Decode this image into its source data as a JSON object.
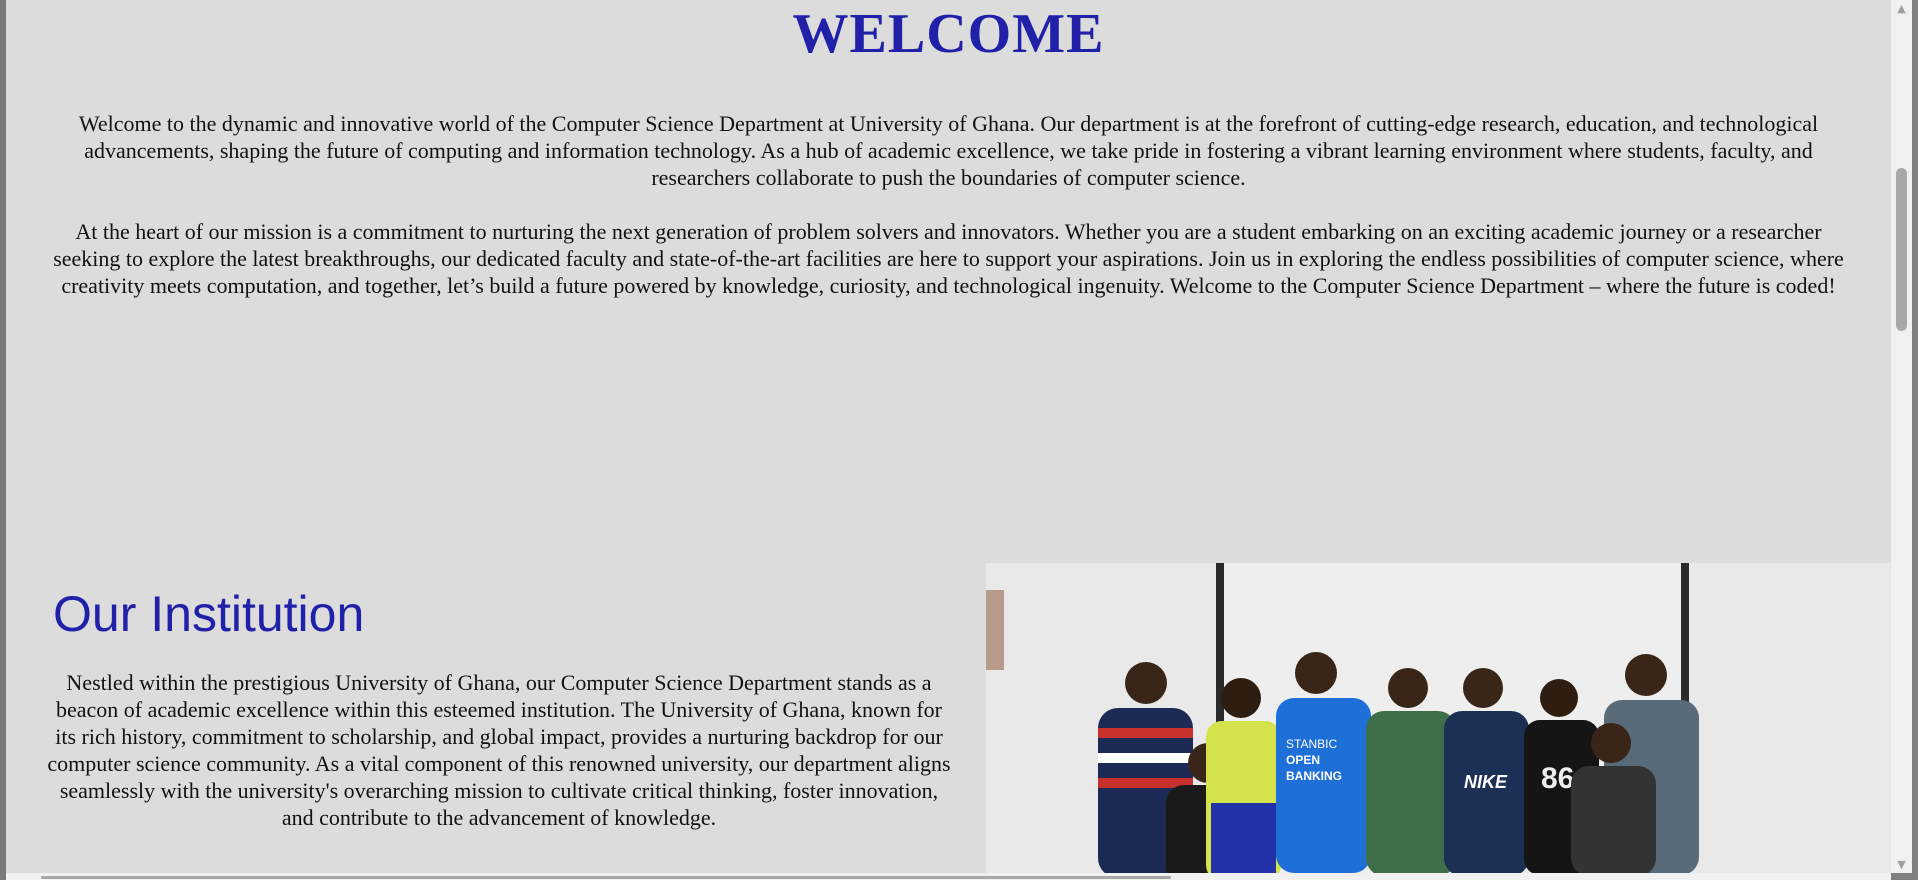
{
  "welcome": {
    "title": "WELCOME",
    "paragraphs": [
      "Welcome to the dynamic and innovative world of the Computer Science Department at University of Ghana. Our department is at the forefront of cutting-edge research, education, and technological advancements, shaping the future of computing and information technology. As a hub of academic excellence, we take pride in fostering a vibrant learning environment where students, faculty, and researchers collaborate to push the boundaries of computer science.",
      "At the heart of our mission is a commitment to nurturing the next generation of problem solvers and innovators. Whether you are a student embarking on an exciting academic journey or a researcher seeking to explore the latest breakthroughs, our dedicated faculty and state-of-the-art facilities are here to support your aspirations. Join us in exploring the endless possibilities of computer science, where creativity meets computation, and together, let’s build a future powered by knowledge, curiosity, and technological ingenuity. Welcome to the Computer Science Department – where the future is coded!"
    ]
  },
  "institution": {
    "title": "Our Institution",
    "text": "Nestled within the prestigious University of Ghana, our Computer Science Department stands as a beacon of academic excellence within this esteemed institution. The University of Ghana, known for its rich history, commitment to scholarship, and global impact, provides a nurturing backdrop for our computer science community. As a vital component of this renowned university, our department aligns seamlessly with the university's overarching mission to cultivate critical thinking, foster innovation, and contribute to the advancement of knowledge.",
    "photo": {
      "shirt_lines": [
        "STANBIC",
        "OPEN",
        "BANKING"
      ],
      "shirt_brand": "NIKE",
      "shirt_number": "86"
    }
  },
  "colors": {
    "heading": "#2020a8",
    "background": "#dcdcdc"
  }
}
